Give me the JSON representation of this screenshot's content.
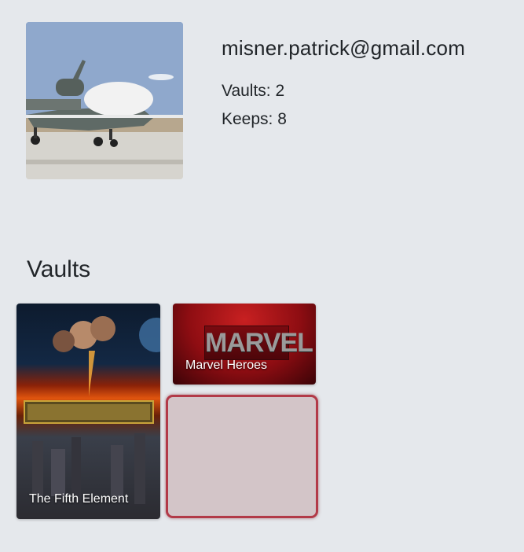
{
  "profile": {
    "email": "misner.patrick@gmail.com",
    "vaults_text": "Vaults: 2",
    "keeps_text": "Keeps: 8",
    "avatar_alt": "Global Hawk drone on runway"
  },
  "vaults_section": {
    "title": "Vaults",
    "items": [
      {
        "name": "The Fifth Element"
      },
      {
        "name": "Marvel Heroes",
        "logo_text": "MARVEL"
      }
    ]
  },
  "colors": {
    "background": "#e5e8ec",
    "accent_border": "#b23a48"
  }
}
